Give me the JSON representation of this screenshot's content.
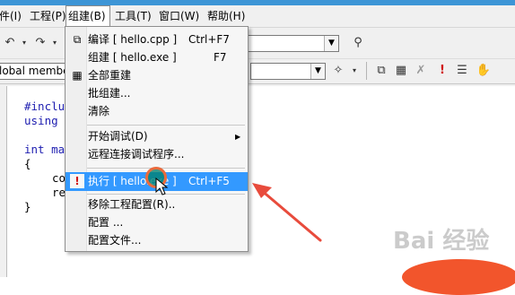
{
  "menubar": {
    "items": [
      {
        "label": "件(I)"
      },
      {
        "label": "工程(P)"
      },
      {
        "label": "组建(B)"
      },
      {
        "label": "工具(T)"
      },
      {
        "label": "窗口(W)"
      },
      {
        "label": "帮助(H)"
      }
    ]
  },
  "toolbar": {
    "members_combo": "lobal members]"
  },
  "editor": {
    "lines": [
      "#inclu",
      "using",
      "",
      "int ma",
      "{",
      "co",
      "re",
      "}"
    ]
  },
  "build_menu": {
    "items": [
      {
        "label": "编译 [ hello.cpp ]",
        "shortcut": "Ctrl+F7",
        "icon": "compile-icon"
      },
      {
        "label": "组建 [ hello.exe ]",
        "shortcut": "F7",
        "icon": ""
      },
      {
        "label": "全部重建",
        "shortcut": "",
        "icon": "rebuild-all-icon"
      },
      {
        "label": "批组建...",
        "shortcut": "",
        "icon": ""
      },
      {
        "label": "清除",
        "shortcut": "",
        "icon": ""
      },
      {
        "label": "开始调试(D)",
        "shortcut": "",
        "icon": ""
      },
      {
        "label": "远程连接调试程序...",
        "shortcut": "",
        "icon": ""
      },
      {
        "label": "执行 [ hello.exe ]",
        "shortcut": "Ctrl+F5",
        "icon": "execute-icon"
      },
      {
        "label": "移除工程配置(R)..",
        "shortcut": "",
        "icon": ""
      },
      {
        "label": "配置 ...",
        "shortcut": "",
        "icon": ""
      },
      {
        "label": "配置文件...",
        "shortcut": "",
        "icon": ""
      }
    ]
  },
  "watermark": "Bai 经验",
  "colors": {
    "highlight": "#3399ff",
    "annotation": "#e84b3c"
  }
}
